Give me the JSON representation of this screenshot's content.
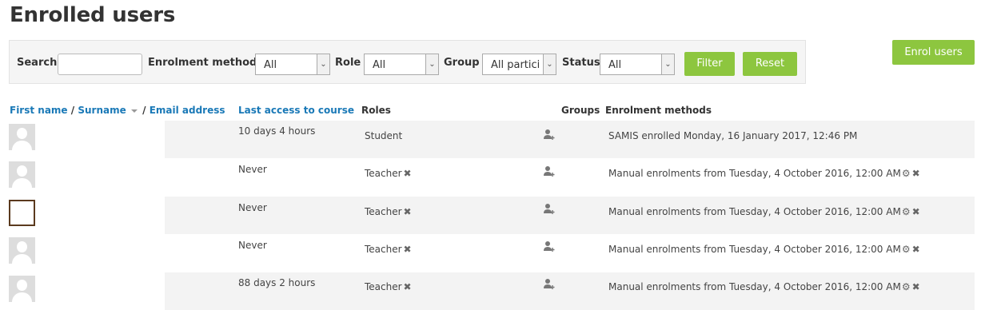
{
  "page": {
    "title": "Enrolled users"
  },
  "filters": {
    "search_label": "Search",
    "search_value": "",
    "enrolment_label": "Enrolment methods",
    "enrolment_value": "All",
    "role_label": "Role",
    "role_value": "All",
    "group_label": "Group",
    "group_value": "All particip",
    "status_label": "Status",
    "status_value": "All",
    "filter_button": "Filter",
    "reset_button": "Reset"
  },
  "enrol_users_button": "Enrol users",
  "table": {
    "headers": {
      "first_name": "First name",
      "sep1": "/",
      "surname": "Surname",
      "sep2": "/",
      "email": "Email address",
      "last_access": "Last access to course",
      "roles": "Roles",
      "groups": "Groups",
      "enrolment_methods": "Enrolment methods"
    },
    "rows": [
      {
        "last_access": "10 days 4 hours",
        "role": "Student",
        "enrolment": "SAMIS enrolled Monday, 16 January 2017, 12:46 PM"
      },
      {
        "last_access": "Never",
        "role": "Teacher",
        "enrolment": "Manual enrolments from Tuesday, 4 October 2016, 12:00 AM"
      },
      {
        "last_access": "Never",
        "role": "Teacher",
        "enrolment": "Manual enrolments from Tuesday, 4 October 2016, 12:00 AM"
      },
      {
        "last_access": "Never",
        "role": "Teacher",
        "enrolment": "Manual enrolments from Tuesday, 4 October 2016, 12:00 AM"
      },
      {
        "last_access": "88 days 2 hours",
        "role": "Teacher",
        "enrolment": "Manual enrolments from Tuesday, 4 October 2016, 12:00 AM"
      }
    ]
  },
  "icons": {
    "remove_role": "close-icon",
    "edit_enrolment": "gear-icon",
    "unenrol": "close-icon",
    "add_group": "add-group-icon"
  },
  "colors": {
    "accent": "#8dc63f",
    "link": "#1a79b7"
  }
}
